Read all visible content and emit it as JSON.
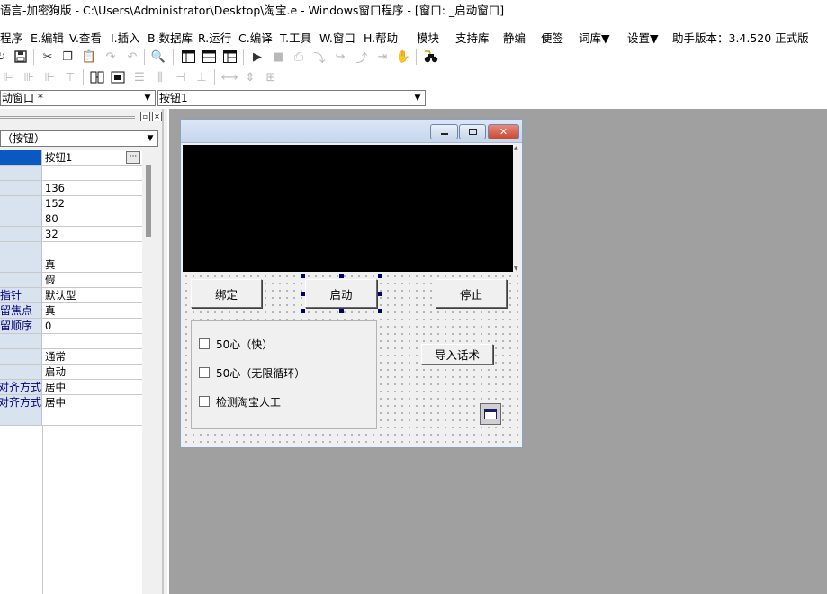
{
  "title_bar": {
    "text": "语言-加密狗版 - C:\\Users\\Administrator\\Desktop\\淘宝.e - Windows窗口程序 - [窗口: _启动窗口]"
  },
  "menu": {
    "items": [
      "程序",
      "E.编辑",
      "V.查看",
      "I.插入",
      "B.数据库",
      "R.运行",
      "C.编译",
      "T.工具",
      "W.窗口",
      "H.帮助",
      "模块",
      "支持库",
      "静编",
      "便签",
      "词库▼",
      "设置▼"
    ],
    "version_label": "助手版本：3.4.520 正式版"
  },
  "selector_bar": {
    "window_combo": "动窗口 *",
    "control_combo": "按钮1"
  },
  "property_panel": {
    "object_combo": "（按钮）",
    "rows": [
      {
        "name": "",
        "value": "按钮1"
      },
      {
        "name": "",
        "value": ""
      },
      {
        "name": "",
        "value": "136"
      },
      {
        "name": "",
        "value": "152"
      },
      {
        "name": "",
        "value": "80"
      },
      {
        "name": "",
        "value": "32"
      },
      {
        "name": "",
        "value": ""
      },
      {
        "name": "",
        "value": "真"
      },
      {
        "name": "",
        "value": "假"
      },
      {
        "name": "指针",
        "value": "默认型"
      },
      {
        "name": "留焦点",
        "value": "真"
      },
      {
        "name": "留顺序",
        "value": "0"
      },
      {
        "name": "",
        "value": ""
      },
      {
        "name": "",
        "value": "通常"
      },
      {
        "name": "",
        "value": "启动"
      },
      {
        "name": "对齐方式",
        "value": "居中"
      },
      {
        "name": "对齐方式",
        "value": "居中"
      },
      {
        "name": "",
        "value": ""
      }
    ]
  },
  "form": {
    "buttons": {
      "bind": "绑定",
      "start": "启动",
      "stop": "停止",
      "import": "导入话术"
    },
    "checkboxes": [
      "50心（快）",
      "50心（无限循环）",
      "检测淘宝人工"
    ]
  },
  "colors": {
    "design_bg": "#a0a0a0",
    "selected_row": "#0a58c2",
    "selection_handle": "#00006e",
    "close_button": "#c84a33"
  },
  "icons": {
    "toolbar1": [
      "redo-arrow-icon",
      "save-icon",
      "cut-icon",
      "copy-icon",
      "paste-icon",
      "redo-icon",
      "undo-icon",
      "find-icon",
      "layout-icon-1",
      "layout-icon-2",
      "layout-icon-3",
      "run-icon",
      "stop-icon",
      "compile-icon",
      "step-into-icon",
      "step-over-icon",
      "step-out-icon",
      "run-to-cursor-icon",
      "hand-icon",
      "search-binoculars-icon"
    ],
    "toolbar2": [
      "align-left-icon",
      "align-center-h-icon",
      "align-right-icon",
      "align-top-icon",
      "same-width-icon",
      "same-height-icon",
      "same-size-icon",
      "center-h-icon",
      "center-v-icon",
      "space-h-icon",
      "space-v-icon",
      "grid-icon"
    ]
  }
}
